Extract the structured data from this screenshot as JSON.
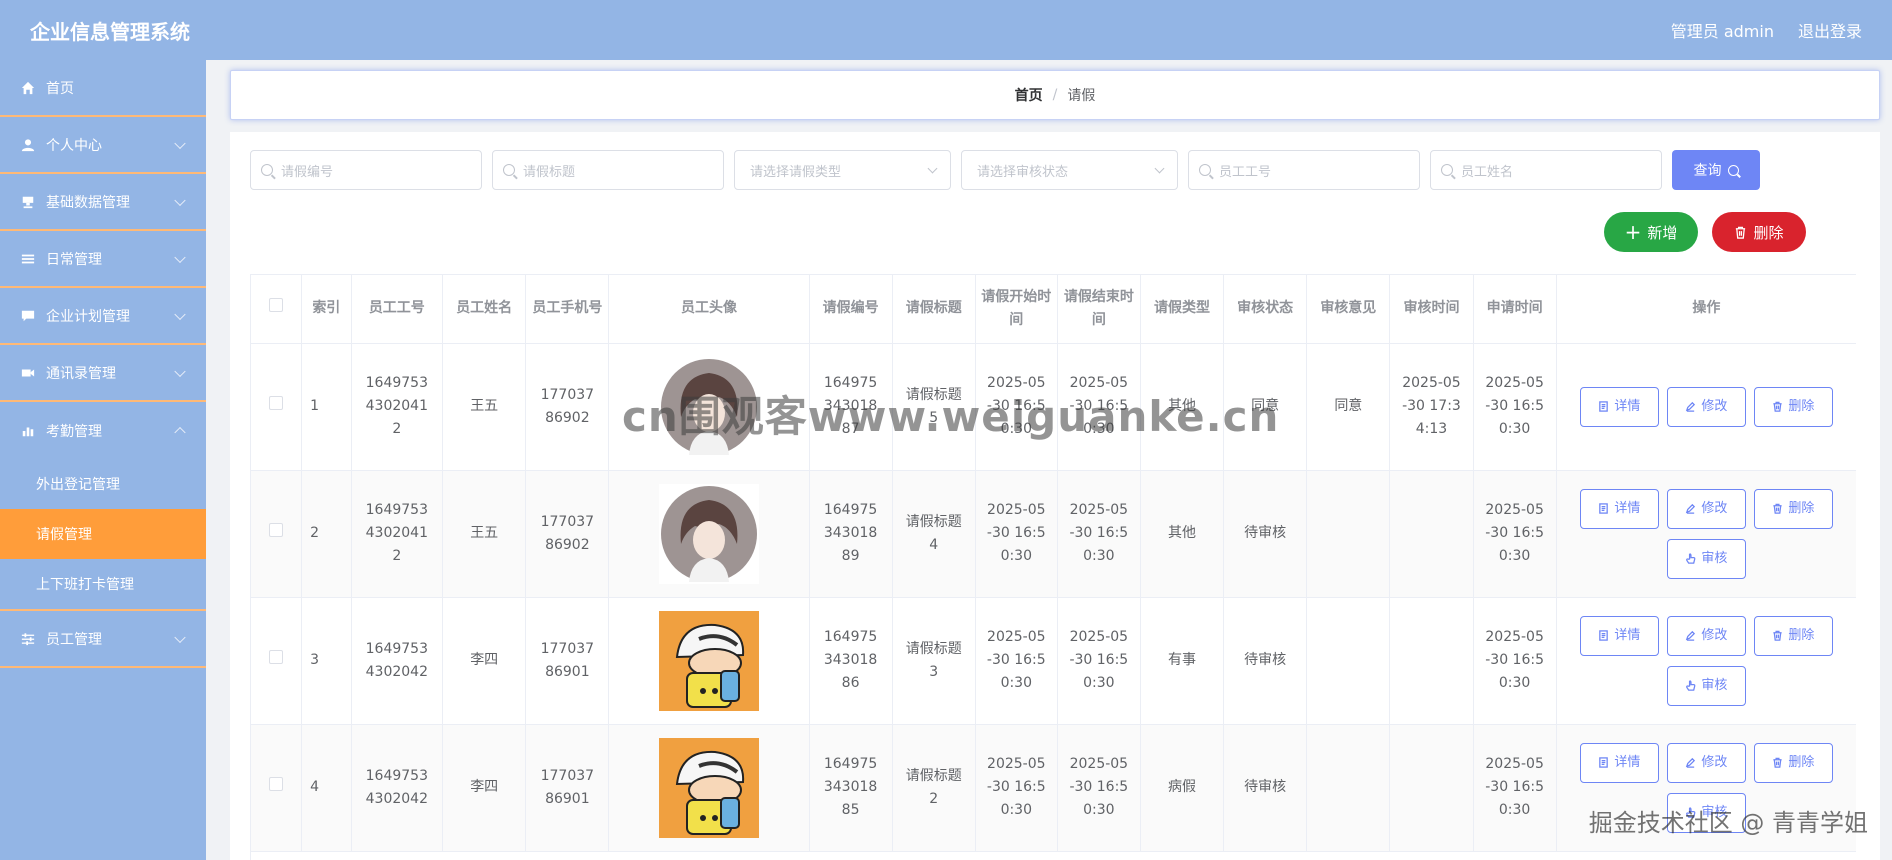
{
  "app": {
    "title": "企业信息管理系统",
    "user": "管理员 admin",
    "logout": "退出登录"
  },
  "sidebar": {
    "items": [
      {
        "label": "首页",
        "icon": "home-icon"
      },
      {
        "label": "个人中心",
        "icon": "user-icon"
      },
      {
        "label": "基础数据管理",
        "icon": "stamp-icon"
      },
      {
        "label": "日常管理",
        "icon": "list-icon"
      },
      {
        "label": "企业计划管理",
        "icon": "chat-icon"
      },
      {
        "label": "通讯录管理",
        "icon": "video-icon"
      },
      {
        "label": "考勤管理",
        "icon": "chart-icon"
      }
    ],
    "submenu": [
      "外出登记管理",
      "请假管理",
      "上下班打卡管理"
    ],
    "last_item": {
      "label": "员工管理",
      "icon": "sliders-icon"
    }
  },
  "breadcrumb": {
    "home": "首页",
    "sep": "/",
    "current": "请假"
  },
  "search": {
    "leave_no": "请假编号",
    "leave_title": "请假标题",
    "leave_type": "请选择请假类型",
    "audit_status": "请选择审核状态",
    "emp_no": "员工工号",
    "emp_name": "员工姓名",
    "query": "查询"
  },
  "actions": {
    "add": "新增",
    "delete": "删除"
  },
  "table": {
    "headers": [
      "索引",
      "员工工号",
      "员工姓名",
      "员工手机号",
      "员工头像",
      "请假编号",
      "请假标题",
      "请假开始时间",
      "请假结束时间",
      "请假类型",
      "审核状态",
      "审核意见",
      "审核时间",
      "申请时间",
      "操作"
    ],
    "op_labels": {
      "detail": "详情",
      "edit": "修改",
      "delete": "删除",
      "audit": "审核"
    },
    "rows": [
      {
        "index": "1",
        "emp_no": "164975343020412",
        "name": "王五",
        "phone": "17703786902",
        "avatar": "girl",
        "leave_no": "16497534301887",
        "title": "请假标题5",
        "start": "2025-05-30 16:50:30",
        "end": "2025-05-30 16:50:30",
        "type": "其他",
        "status": "同意",
        "opinion": "同意",
        "audit_time": "2025-05-30 17:34:13",
        "apply_time": "2025-05-30 16:50:30",
        "audit_btn": false
      },
      {
        "index": "2",
        "emp_no": "164975343020412",
        "name": "王五",
        "phone": "17703786902",
        "avatar": "girl",
        "leave_no": "16497534301889",
        "title": "请假标题4",
        "start": "2025-05-30 16:50:30",
        "end": "2025-05-30 16:50:30",
        "type": "其他",
        "status": "待审核",
        "opinion": "",
        "audit_time": "",
        "apply_time": "2025-05-30 16:50:30",
        "audit_btn": true
      },
      {
        "index": "3",
        "emp_no": "16497534302042",
        "name": "李四",
        "phone": "17703786901",
        "avatar": "cartoon",
        "leave_no": "16497534301886",
        "title": "请假标题3",
        "start": "2025-05-30 16:50:30",
        "end": "2025-05-30 16:50:30",
        "type": "有事",
        "status": "待审核",
        "opinion": "",
        "audit_time": "",
        "apply_time": "2025-05-30 16:50:30",
        "audit_btn": true
      },
      {
        "index": "4",
        "emp_no": "16497534302042",
        "name": "李四",
        "phone": "17703786901",
        "avatar": "cartoon",
        "leave_no": "16497534301885",
        "title": "请假标题2",
        "start": "2025-05-30 16:50:30",
        "end": "2025-05-30 16:50:30",
        "type": "病假",
        "status": "待审核",
        "opinion": "",
        "audit_time": "",
        "apply_time": "2025-05-30 16:50:30",
        "audit_btn": true
      }
    ]
  },
  "watermarks": {
    "center": "cn围观客www.weiguanke.cn",
    "corner": "掘金技术社区 @ 青青学姐"
  },
  "colors": {
    "header": "#93b5e5",
    "active_menu": "#ff9d3a",
    "primary": "#6e86f5",
    "success": "#28a745",
    "danger": "#d9232d"
  }
}
